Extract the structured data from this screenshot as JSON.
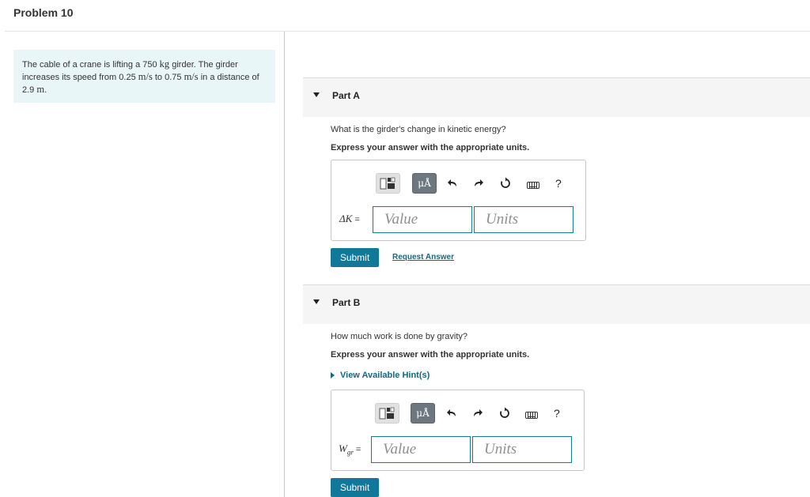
{
  "page": {
    "title": "Problem 10"
  },
  "problem": {
    "text_1": "The cable of a crane is lifting a 750 ",
    "unit_kg": "kg",
    "text_2": " girder. The girder increases its speed from 0.25 ",
    "unit_ms_1": "m/s",
    "text_3": " to 0.75 ",
    "unit_ms_2": "m/s",
    "text_4": " in a distance of 2.9 ",
    "unit_m": "m",
    "text_5": "."
  },
  "toolbar": {
    "mu_label": "μÅ",
    "help_label": "?",
    "icons": [
      "templates-icon",
      "units-mu-icon",
      "undo-icon",
      "redo-icon",
      "reset-icon",
      "keyboard-icon",
      "help-icon"
    ]
  },
  "parts": [
    {
      "label": "Part A",
      "question": "What is the girder's change in kinetic energy?",
      "instruction": "Express your answer with the appropriate units.",
      "variable": "ΔK",
      "equals": " =",
      "value_placeholder": "Value",
      "units_placeholder": "Units",
      "submit_label": "Submit",
      "request_label": "Request Answer"
    },
    {
      "label": "Part B",
      "question": "How much work is done by gravity?",
      "instruction": "Express your answer with the appropriate units.",
      "hint_label": "View Available Hint(s)",
      "variable": "W",
      "variable_sub": "gr",
      "equals": " =",
      "value_placeholder": "Value",
      "units_placeholder": "Units",
      "submit_label": "Submit"
    }
  ],
  "colors": {
    "accent": "#12789a",
    "link": "#0e6b82",
    "problem_bg": "#e8f6f8",
    "input_border": "#137b94"
  }
}
